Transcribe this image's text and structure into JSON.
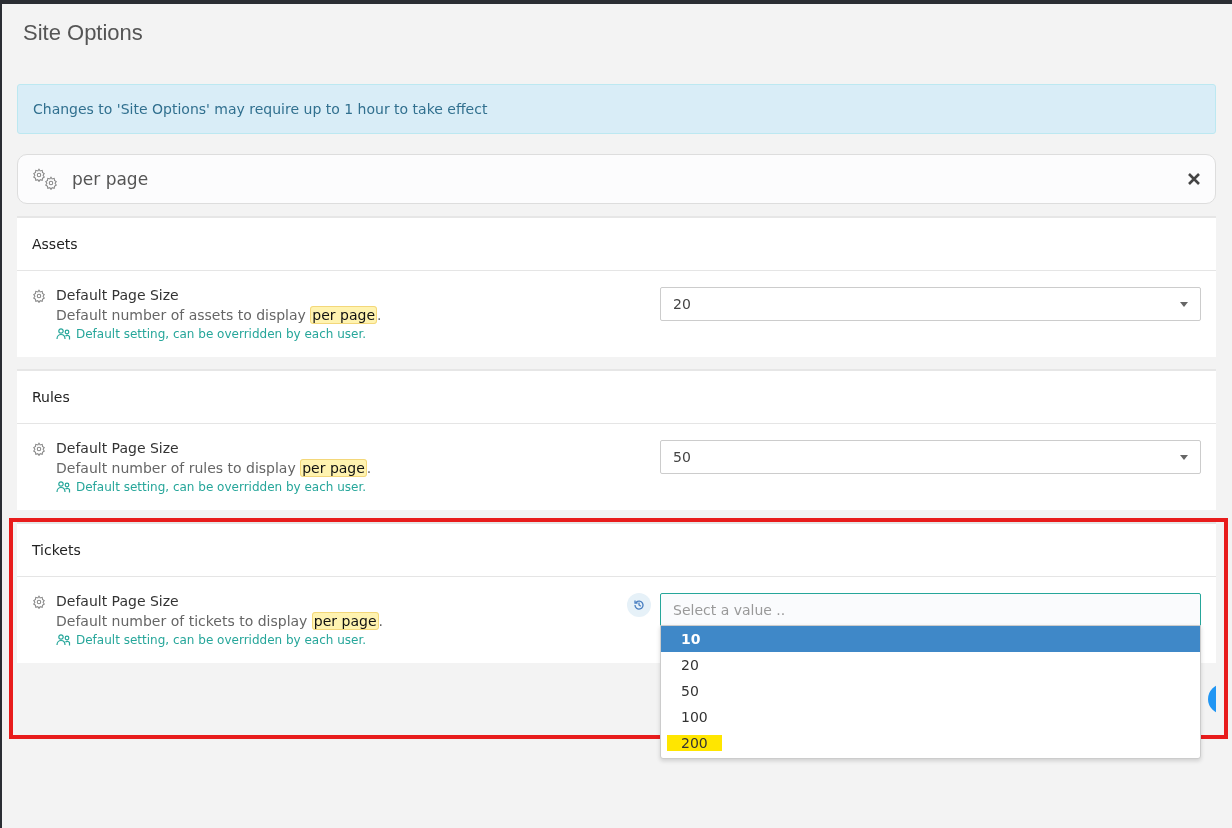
{
  "page": {
    "title": "Site Options"
  },
  "alert": {
    "text": "Changes to 'Site Options' may require up to 1 hour to take effect"
  },
  "search": {
    "value": "per page"
  },
  "sections": [
    {
      "title": "Assets",
      "annotated": false,
      "settings": [
        {
          "label": "Default Page Size",
          "description": "Default number of assets to display ",
          "match": "per page",
          "suffix": ".",
          "note": "Default setting, can be overridden by each user.",
          "modified": false,
          "select": {
            "value": "20",
            "open": false
          }
        }
      ]
    },
    {
      "title": "Rules",
      "annotated": false,
      "settings": [
        {
          "label": "Default Page Size",
          "description": "Default number of rules to display ",
          "match": "per page",
          "suffix": ".",
          "note": "Default setting, can be overridden by each user.",
          "modified": false,
          "select": {
            "value": "50",
            "open": false
          }
        }
      ]
    },
    {
      "title": "Tickets",
      "annotated": true,
      "settings": [
        {
          "label": "Default Page Size",
          "description": "Default number of tickets to display ",
          "match": "per page",
          "suffix": ".",
          "note": "Default setting, can be overridden by each user.",
          "modified": true,
          "select": {
            "placeholder": "Select a value ..",
            "open": true,
            "options": [
              {
                "label": "10",
                "selected": true,
                "highlighted": false
              },
              {
                "label": "20",
                "selected": false,
                "highlighted": false
              },
              {
                "label": "50",
                "selected": false,
                "highlighted": false
              },
              {
                "label": "100",
                "selected": false,
                "highlighted": false
              },
              {
                "label": "200",
                "selected": false,
                "highlighted": true
              }
            ]
          }
        }
      ]
    }
  ]
}
